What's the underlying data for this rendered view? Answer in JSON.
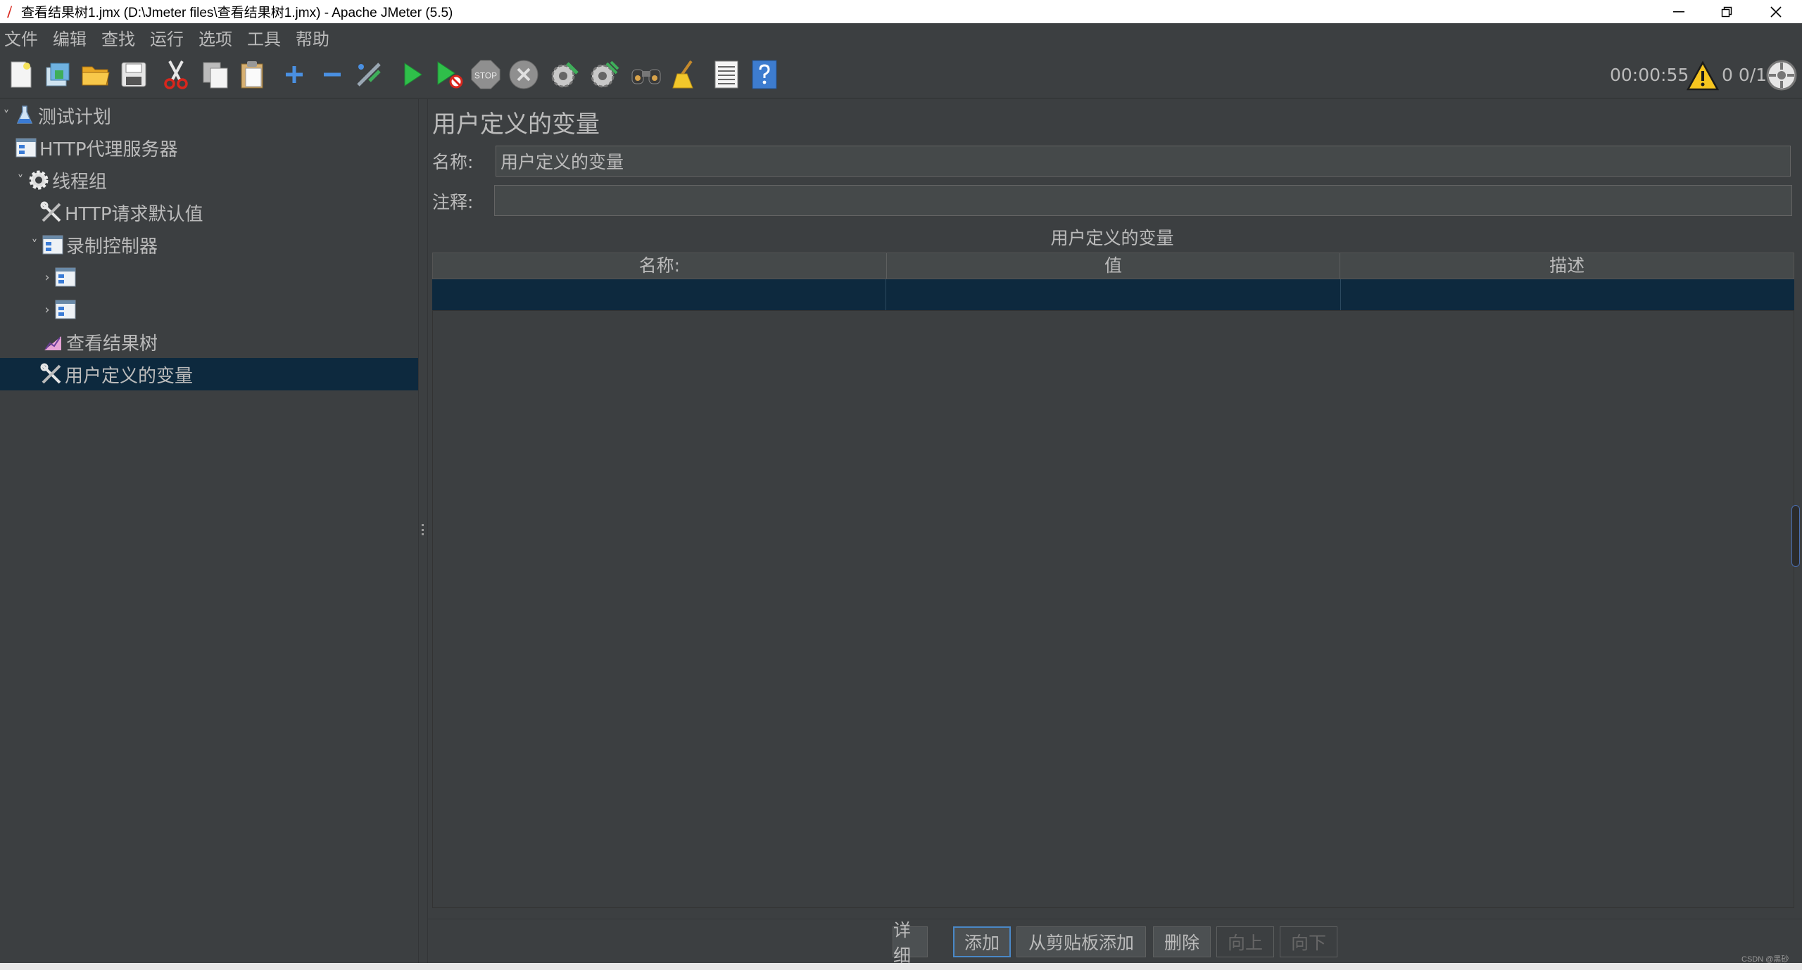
{
  "window": {
    "title": "查看结果树1.jmx (D:\\Jmeter files\\查看结果树1.jmx) - Apache JMeter (5.5)",
    "controls": {
      "minimize": "—",
      "restore": "❐",
      "close": "✕"
    }
  },
  "menu": [
    "文件",
    "编辑",
    "查找",
    "运行",
    "选项",
    "工具",
    "帮助"
  ],
  "toolbar": {
    "icons": [
      "new-icon",
      "templates-icon",
      "open-icon",
      "save-icon",
      "cut-icon",
      "copy-icon",
      "paste-icon",
      "expand-icon",
      "collapse-icon",
      "toggle-icon",
      "start-icon",
      "start-no-timers-icon",
      "stop-icon",
      "shutdown-icon",
      "clear-icon",
      "clear-all-icon",
      "search-icon",
      "reset-search-icon",
      "function-helper-icon",
      "help-icon"
    ],
    "stop_label": "STOP",
    "timer": "00:00:55",
    "thread_counts": "0 0/1"
  },
  "tree": {
    "nodes": [
      {
        "label": "测试计划",
        "icon": "flask-icon",
        "toggle": "˅"
      },
      {
        "label": "HTTP代理服务器",
        "icon": "proxy-icon",
        "toggle": ""
      },
      {
        "label": "线程组",
        "icon": "gear-icon",
        "toggle": "˅"
      },
      {
        "label": "HTTP请求默认值",
        "icon": "tools-icon",
        "toggle": ""
      },
      {
        "label": "录制控制器",
        "icon": "controller-icon",
        "toggle": "˅"
      },
      {
        "label": "",
        "icon": "controller-icon",
        "toggle": "›"
      },
      {
        "label": "",
        "icon": "controller-icon",
        "toggle": "›"
      },
      {
        "label": "查看结果树",
        "icon": "chart-icon",
        "toggle": ""
      },
      {
        "label": "用户定义的变量",
        "icon": "tools-icon",
        "toggle": ""
      }
    ]
  },
  "panel": {
    "title": "用户定义的变量",
    "name_label": "名称:",
    "name_value": "用户定义的变量",
    "comment_label": "注释:",
    "comment_value": "",
    "table_caption": "用户定义的变量",
    "columns": [
      "名称:",
      "值",
      "描述"
    ],
    "buttons": {
      "detail": "详细",
      "add": "添加",
      "add_from_clipboard": "从剪贴板添加",
      "delete": "删除",
      "up": "向上",
      "down": "向下"
    }
  },
  "watermark": "CSDN @黑砂"
}
